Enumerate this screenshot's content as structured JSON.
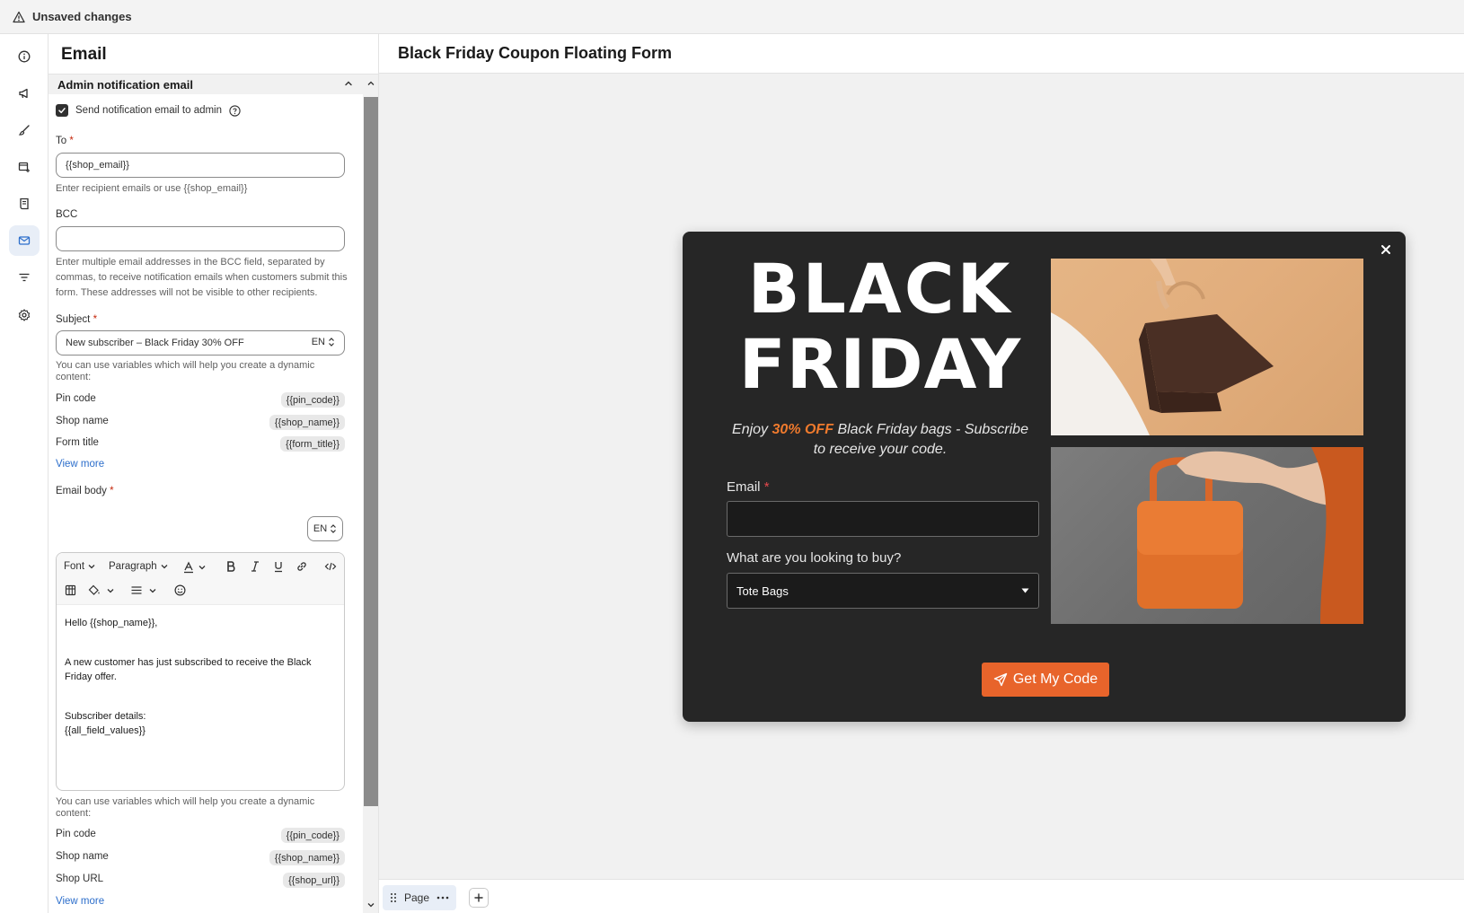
{
  "topbar": {
    "status": "Unsaved changes"
  },
  "rail": {
    "items": [
      {
        "icon": "info-icon"
      },
      {
        "icon": "megaphone-icon"
      },
      {
        "icon": "brush-icon"
      },
      {
        "icon": "layout-add-icon"
      },
      {
        "icon": "receipt-icon"
      },
      {
        "icon": "email-icon",
        "active": true
      },
      {
        "icon": "filter-icon"
      },
      {
        "icon": "gear-icon"
      }
    ]
  },
  "panel": {
    "title": "Email",
    "section_title": "Admin notification email",
    "send_checkbox_label": "Send notification email to admin",
    "to": {
      "label": "To",
      "value": "{{shop_email}}",
      "help": "Enter recipient emails or use {{shop_email}}"
    },
    "bcc": {
      "label": "BCC",
      "value": "",
      "help": "Enter multiple email addresses in the BCC field, separated by commas, to receive notification emails when customers submit this form. These addresses will not be visible to other recipients."
    },
    "subject": {
      "label": "Subject",
      "value": "New subscriber – Black Friday 30% OFF",
      "lang": "EN"
    },
    "variables_help": "You can use variables which will help you create a dynamic content:",
    "subject_vars": [
      {
        "name": "Pin code",
        "token": "{{pin_code}}"
      },
      {
        "name": "Shop name",
        "token": "{{shop_name}}"
      },
      {
        "name": "Form title",
        "token": "{{form_title}}"
      }
    ],
    "view_more": "View more",
    "body": {
      "label": "Email body",
      "lang": "EN",
      "toolbar": {
        "font": "Font",
        "paragraph": "Paragraph"
      },
      "lines": [
        "Hello {{shop_name}},",
        "A new customer has just subscribed to receive the Black Friday offer.",
        "Subscriber details:",
        "{{all_field_values}}"
      ]
    },
    "body_vars": [
      {
        "name": "Pin code",
        "token": "{{pin_code}}"
      },
      {
        "name": "Shop name",
        "token": "{{shop_name}}"
      },
      {
        "name": "Shop URL",
        "token": "{{shop_url}}"
      }
    ]
  },
  "main": {
    "title": "Black Friday Coupon Floating Form",
    "popup": {
      "headline_1": "BLACK",
      "headline_2": "FRIDAY",
      "tagline_pre": "Enjoy",
      "tagline_hl": "30% OFF",
      "tagline_post": "Black Friday bags - Subscribe to receive your code.",
      "email_label": "Email",
      "buy_label": "What are you looking to buy?",
      "buy_value": "Tote Bags",
      "cta": "Get My Code",
      "accent": "#e8642b"
    },
    "bottom": {
      "page_tab": "Page"
    }
  }
}
